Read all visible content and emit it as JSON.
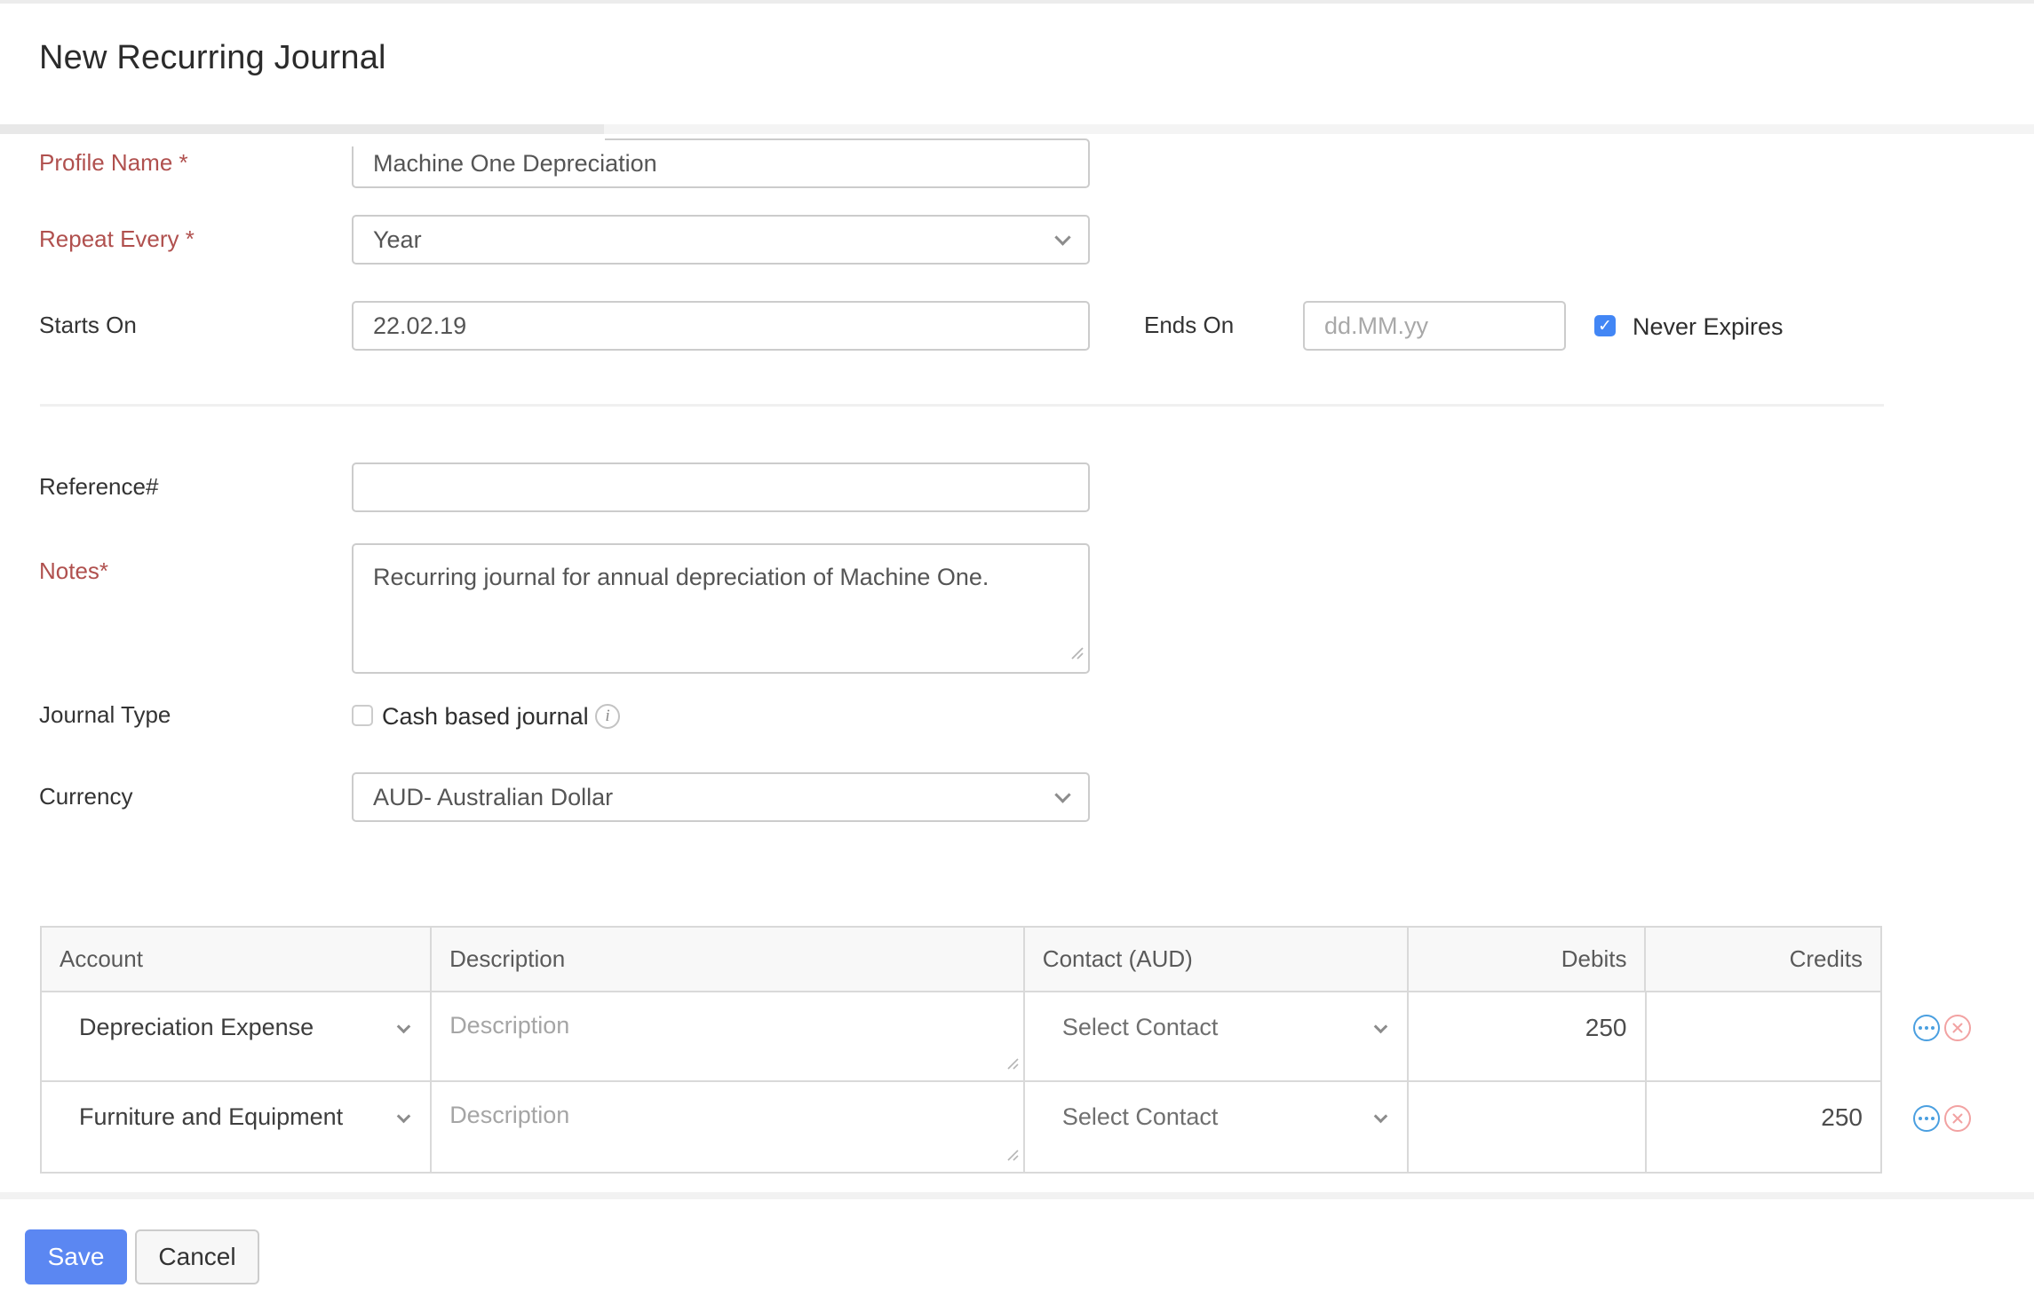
{
  "header": {
    "title": "New Recurring Journal"
  },
  "form": {
    "profile_name": {
      "label": "Profile Name *",
      "value": "Machine One Depreciation"
    },
    "repeat_every": {
      "label": "Repeat Every *",
      "value": "Year"
    },
    "starts_on": {
      "label": "Starts On",
      "value": "22.02.19"
    },
    "ends_on": {
      "label": "Ends On",
      "placeholder": "dd.MM.yy"
    },
    "never_expires": {
      "label": "Never Expires",
      "checked": true,
      "check_glyph": "✓"
    },
    "reference": {
      "label": "Reference#",
      "value": ""
    },
    "notes": {
      "label": "Notes*",
      "value": "Recurring journal for annual depreciation of Machine One."
    },
    "journal_type": {
      "label": "Journal Type",
      "checkbox_label": "Cash based journal",
      "checked": false,
      "info_glyph": "i"
    },
    "currency": {
      "label": "Currency",
      "value": "AUD- Australian Dollar"
    }
  },
  "table": {
    "headers": {
      "account": "Account",
      "description": "Description",
      "contact": "Contact (AUD)",
      "debits": "Debits",
      "credits": "Credits"
    },
    "rows": [
      {
        "account": "Depreciation Expense",
        "description_placeholder": "Description",
        "contact_placeholder": "Select Contact",
        "debits": "250",
        "credits": ""
      },
      {
        "account": "Furniture and Equipment",
        "description_placeholder": "Description",
        "contact_placeholder": "Select Contact",
        "debits": "",
        "credits": "250"
      }
    ]
  },
  "footer": {
    "save_label": "Save",
    "cancel_label": "Cancel"
  },
  "colors": {
    "accent_blue": "#5b87f2",
    "checkbox_blue": "#4286f5",
    "required_red": "#b0504e",
    "row_more_icon_blue": "#4a9fe0",
    "row_remove_icon_pink": "#f2a2a2"
  }
}
